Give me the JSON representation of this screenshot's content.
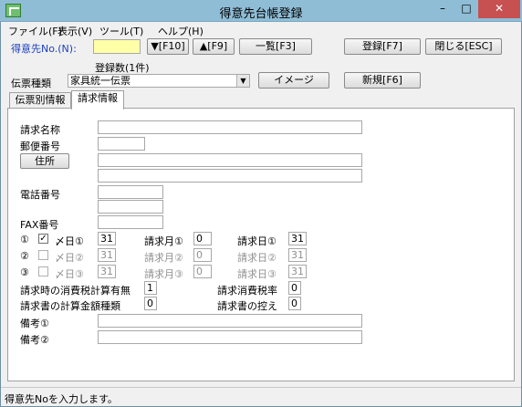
{
  "window": {
    "title": "得意先台帳登録",
    "minimize": "–",
    "maximize": "□",
    "close": "✕"
  },
  "menu": [
    "ファイル(F)",
    "表示(V)",
    "ツール(T)",
    "ヘルプ(H)"
  ],
  "top": {
    "customer_no_label": "得意先No.(N):",
    "customer_no_value": "",
    "next_btn": "▼[F10]",
    "prev_btn": "▲[F9]",
    "list_btn": "一覧[F3]",
    "save_btn": "登録[F7]",
    "close_btn": "閉じる[ESC]",
    "count_label": "登録数(1件)",
    "slip_type_label": "伝票種類",
    "slip_type_value": "家具統一伝票",
    "image_btn": "イメージ",
    "new_btn": "新規[F6]"
  },
  "tabs": [
    "伝票別情報",
    "請求情報"
  ],
  "form": {
    "billing_name": "請求名称",
    "postal_code": "郵便番号",
    "address_btn": "住所",
    "phone": "電話番号",
    "fax": "FAX番号",
    "rows": [
      {
        "num": "①",
        "checked": true,
        "day_label": "〆日①",
        "day": "31",
        "month_label": "請求月①",
        "month": "0",
        "bill_label": "請求日①",
        "bill": "31",
        "enabled": true
      },
      {
        "num": "②",
        "checked": false,
        "day_label": "〆日②",
        "day": "31",
        "month_label": "請求月②",
        "month": "0",
        "bill_label": "請求日②",
        "bill": "31",
        "enabled": false
      },
      {
        "num": "③",
        "checked": false,
        "day_label": "〆日③",
        "day": "31",
        "month_label": "請求月③",
        "month": "0",
        "bill_label": "請求日③",
        "bill": "31",
        "enabled": false
      }
    ],
    "tax_calc_label": "請求時の消費税計算有無",
    "tax_calc_value": "1",
    "tax_rate_label": "請求消費税率",
    "tax_rate_value": "0",
    "amount_type_label": "請求書の計算金額種類",
    "amount_type_value": "0",
    "copy_label": "請求書の控え",
    "copy_value": "0",
    "note1_label": "備考①",
    "note2_label": "備考②"
  },
  "status": "得意先Noを入力します。",
  "colors": {
    "title_bar": "#8fbdd6",
    "close_btn": "#c75050",
    "customer_no_field": "#ffffa8",
    "label_blue": "#1a3fbf"
  }
}
